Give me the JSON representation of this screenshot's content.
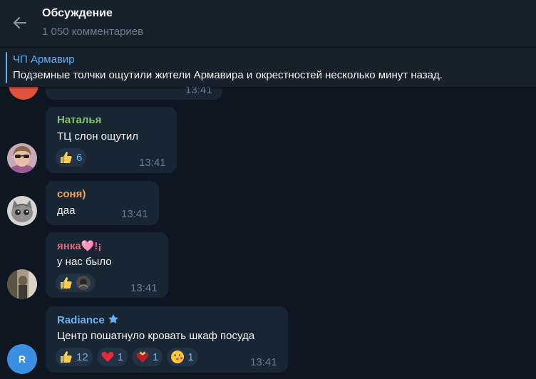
{
  "header": {
    "title": "Обсуждение",
    "subtitle": "1 050 комментариев"
  },
  "pinned": {
    "channel": "ЧП Армавир",
    "text": "Подземные толчки ощутили жители Армавира и окрестностей несколько минут назад."
  },
  "messages": [
    {
      "sender": "",
      "text": "",
      "time": "13:41"
    },
    {
      "sender": "Наталья",
      "sender_color": "#7fc66e",
      "text": "ТЦ слон ощутил",
      "time": "13:41",
      "reactions": [
        {
          "emoji": "thumbs-up",
          "count": "6"
        }
      ]
    },
    {
      "sender": "соня)",
      "sender_color": "#f3a55f",
      "text": "даа",
      "time": "13:41"
    },
    {
      "sender": "янка🩷!¡",
      "sender_color": "#e2667a",
      "text": "у нас было",
      "time": "13:41",
      "reactions": [
        {
          "emoji": "thumbs-up",
          "count": ""
        }
      ]
    },
    {
      "sender": "Radiance",
      "sender_color": "#6ab3f3",
      "avatar_letter": "R",
      "text": "Центр пошатнуло кровать шкаф посуда",
      "time": "13:41",
      "reactions": [
        {
          "emoji": "thumbs-up",
          "count": "12"
        },
        {
          "emoji": "red-heart",
          "count": "1"
        },
        {
          "emoji": "heart-bow",
          "count": "1"
        },
        {
          "emoji": "kissing-face",
          "count": "1"
        }
      ]
    }
  ],
  "colors": {
    "background": "#0e1621",
    "header": "#17212b",
    "bubble": "#182533",
    "accent": "#5caffa",
    "muted": "#6d7f8f"
  }
}
